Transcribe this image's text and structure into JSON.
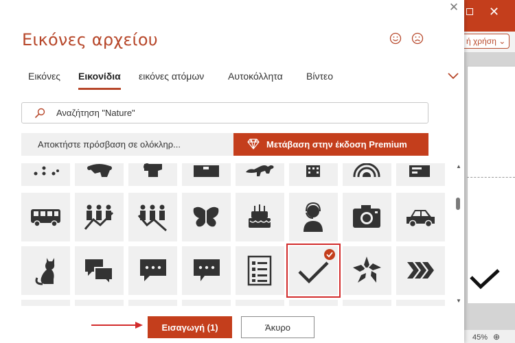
{
  "dialog": {
    "title": "Εικόνες αρχείου",
    "tabs": [
      {
        "label": "Εικόνες",
        "active": false
      },
      {
        "label": "Εικονίδια",
        "active": true
      },
      {
        "label": "εικόνες ατόμων",
        "active": false
      },
      {
        "label": "Αυτοκόλλητα",
        "active": false
      },
      {
        "label": "Βίντεο",
        "active": false
      }
    ],
    "search": {
      "value": "Αναζήτηση \"Nature\""
    },
    "promo": {
      "text": "Αποκτήστε πρόσβαση σε ολόκληρ...",
      "premium_label": "Μετάβαση στην έκδοση Premium"
    },
    "icons": [
      "dots-pattern-icon",
      "connections-head-icon",
      "head-gears-icon",
      "folder-icon",
      "dinosaur-icon",
      "building-icon",
      "target-icon",
      "cash-register-icon",
      "bus-icon",
      "people-growth-icon",
      "people-decline-icon",
      "butterfly-icon",
      "birthday-cake-icon",
      "customer-service-icon",
      "camera-icon",
      "car-icon",
      "cat-icon",
      "chat-bubbles-icon",
      "speech-bubble-icon",
      "comment-icon",
      "checklist-icon",
      "checkmark-icon",
      "teamwork-hands-icon",
      "chevrons-right-icon"
    ],
    "selected_icon": "checkmark-icon",
    "insert_label": "Εισαγωγή (1)",
    "cancel_label": "Άκυρο",
    "accent": "#c43e1c",
    "highlight": "#d22b2b"
  },
  "background_app": {
    "usage_label": "ή χρήση",
    "zoom": "45%"
  }
}
